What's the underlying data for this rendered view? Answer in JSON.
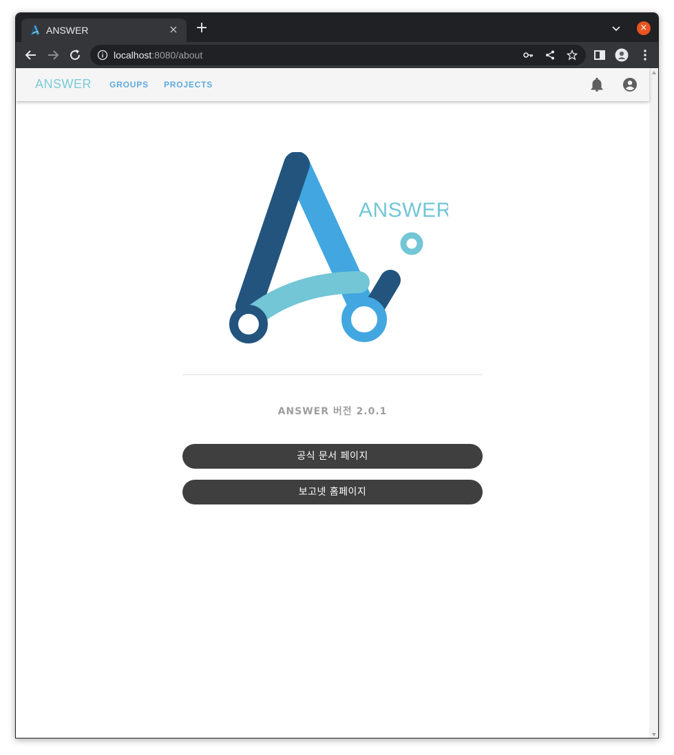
{
  "browser": {
    "tab_title": "ANSWER",
    "tab_close": "×",
    "new_tab": "+",
    "window_close": "×",
    "url_host": "localhost",
    "url_rest": ":8080/about"
  },
  "app": {
    "brand": "ANSWER",
    "nav": [
      "GROUPS",
      "PROJECTS"
    ]
  },
  "about": {
    "logo_text": "ANSWER",
    "version": "ANSWER 버전 2.0.1",
    "docs_button": "공식 문서 페이지",
    "homepage_button": "보고넷 홈페이지"
  },
  "colors": {
    "logo_dark": "#22547e",
    "logo_mid": "#42a7e0",
    "logo_light": "#72c6d6",
    "button_bg": "#3f3f3f",
    "nav_link": "#5da9df"
  }
}
